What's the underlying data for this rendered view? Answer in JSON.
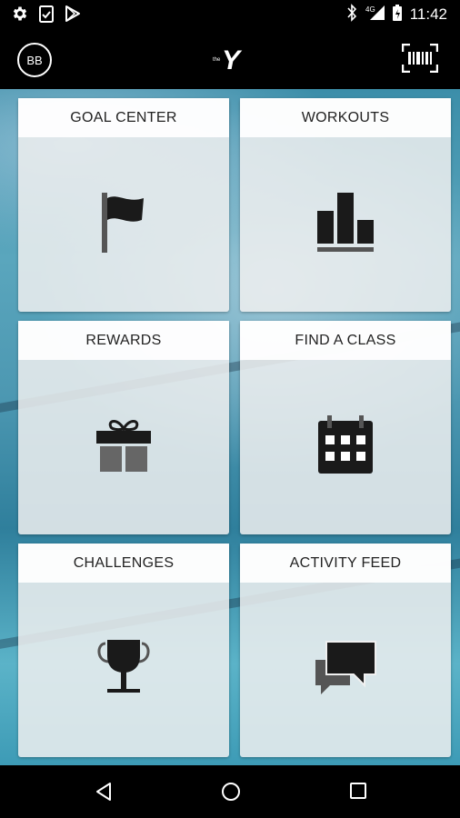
{
  "status_bar": {
    "time": "11:42",
    "left_icons": [
      "settings-icon",
      "clipboard-check-icon",
      "play-store-icon"
    ],
    "right_icons": [
      "bluetooth-icon",
      "signal-4g-icon",
      "battery-icon"
    ],
    "network_label": "4G"
  },
  "app_bar": {
    "avatar_initials": "BB",
    "logo_small_text": "the",
    "logo_letter": "Y",
    "right_action_icon": "barcode-scan-icon"
  },
  "tiles": [
    {
      "label": "GOAL CENTER",
      "icon": "flag-icon"
    },
    {
      "label": "WORKOUTS",
      "icon": "bar-chart-icon"
    },
    {
      "label": "REWARDS",
      "icon": "gift-icon"
    },
    {
      "label": "FIND A CLASS",
      "icon": "calendar-icon"
    },
    {
      "label": "CHALLENGES",
      "icon": "trophy-icon"
    },
    {
      "label": "ACTIVITY FEED",
      "icon": "chat-bubbles-icon"
    }
  ],
  "nav_bar": {
    "buttons": [
      "back-icon",
      "home-icon",
      "recents-icon"
    ]
  },
  "colors": {
    "bar_background": "#000000",
    "tile_background": "#f0f0f0",
    "icon_color": "#1a1a1a"
  }
}
